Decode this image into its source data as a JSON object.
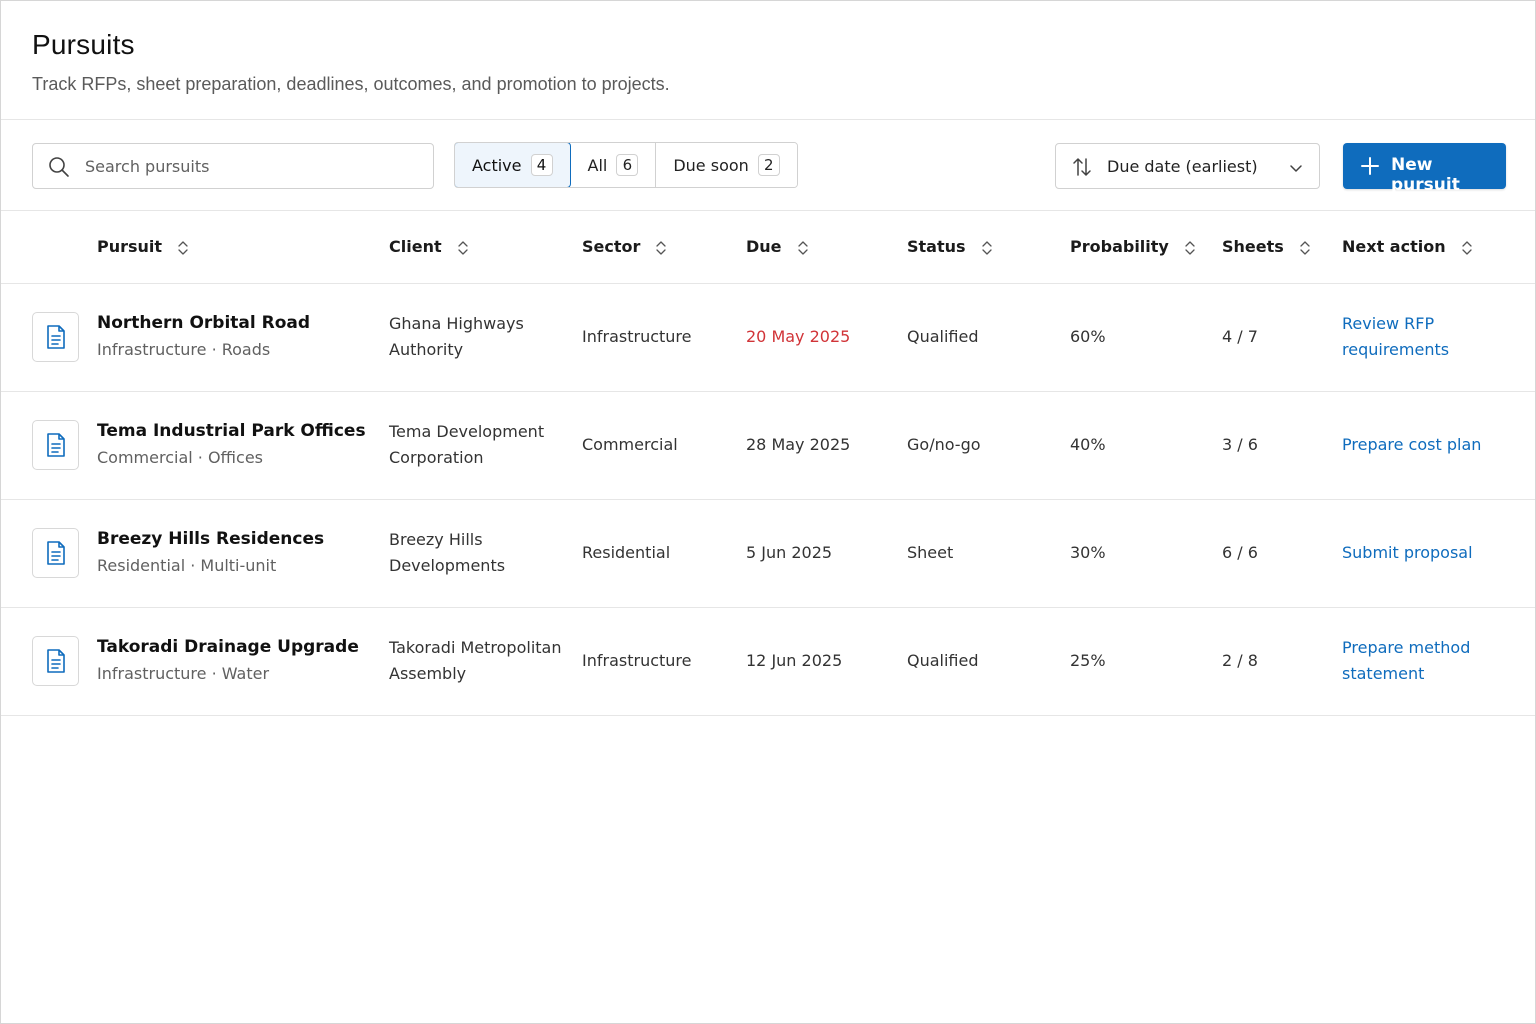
{
  "header": {
    "title": "Pursuits",
    "subtitle": "Track RFPs, sheet preparation, deadlines, outcomes, and promotion to projects."
  },
  "toolbar": {
    "search_placeholder": "Search pursuits",
    "filters": [
      {
        "label": "Active",
        "count": "4",
        "selected": true
      },
      {
        "label": "All",
        "count": "6",
        "selected": false
      },
      {
        "label": "Due soon",
        "count": "2",
        "selected": false
      }
    ],
    "sort_label": "Due date (earliest)",
    "new_button_label": "New pursuit"
  },
  "table": {
    "columns": [
      "Pursuit",
      "Client",
      "Sector",
      "Due",
      "Status",
      "Probability",
      "Sheets",
      "Next action"
    ],
    "rows": [
      {
        "name": "Northern Orbital Road",
        "meta": "Infrastructure · Roads",
        "client": "Ghana Highways Authority",
        "sector": "Infrastructure",
        "due": "20 May 2025",
        "status": "Qualified",
        "probability": "60%",
        "sheets": "4 / 7",
        "next_action": "Review RFP requirements"
      },
      {
        "name": "Tema Industrial Park Offices",
        "meta": "Commercial · Offices",
        "client": "Tema Development Corporation",
        "sector": "Commercial",
        "due": "28 May 2025",
        "status": "Go/no-go",
        "probability": "40%",
        "sheets": "3 / 6",
        "next_action": "Prepare cost plan"
      },
      {
        "name": "Breezy Hills Residences",
        "meta": "Residential · Multi-unit",
        "client": "Breezy Hills Developments",
        "sector": "Residential",
        "due": "5 Jun 2025",
        "status": "Sheet",
        "probability": "30%",
        "sheets": "6 / 6",
        "next_action": "Submit proposal"
      },
      {
        "name": "Takoradi Drainage Upgrade",
        "meta": "Infrastructure · Water",
        "client": "Takoradi Metropolitan Assembly",
        "sector": "Infrastructure",
        "due": "12 Jun 2025",
        "status": "Qualified",
        "probability": "25%",
        "sheets": "2 / 8",
        "next_action": "Prepare method statement"
      }
    ]
  },
  "icons": {
    "search": "search-icon",
    "sort": "sort-arrows-icon",
    "chevron": "chevron-down-icon",
    "add": "plus-icon",
    "row": "document-icon"
  },
  "colors": {
    "accent": "#0f6cbd",
    "urgent_due": "#d13438",
    "active_filter_bg": "#eef5fc"
  }
}
